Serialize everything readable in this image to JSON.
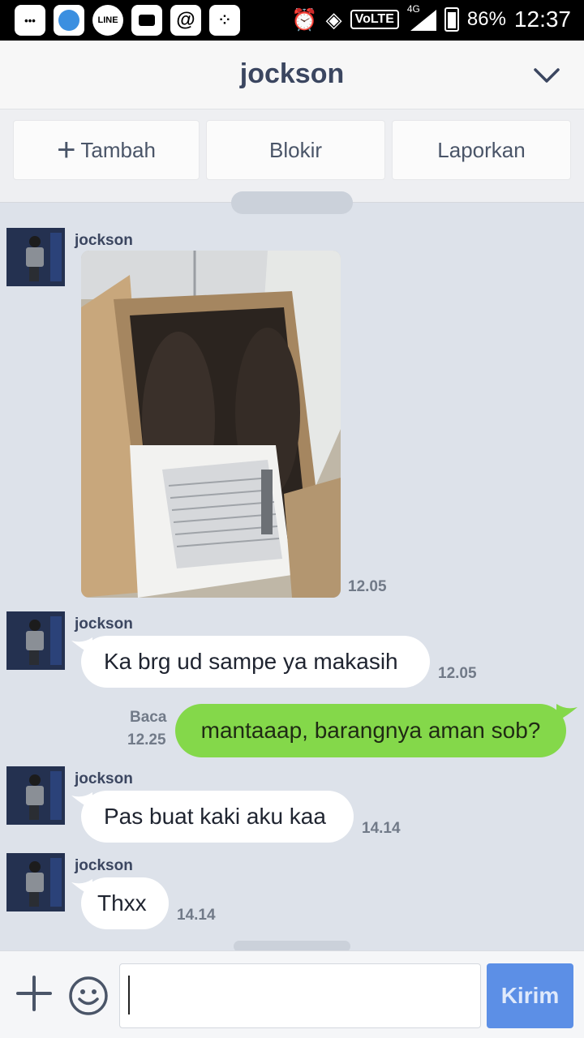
{
  "status_bar": {
    "icons": [
      "more-icon",
      "browser-icon",
      "line-app-icon",
      "chat-icon",
      "at-icon",
      "bbm-icon",
      "alarm-icon",
      "data-icon",
      "volte-icon",
      "signal-4g-icon",
      "battery-charging-icon"
    ],
    "line_label": "LINE",
    "volte_label": "VoLTE",
    "network": "4G",
    "battery": "86%",
    "time": "12:37"
  },
  "header": {
    "title": "jockson",
    "collapse_icon": "chevron-down-icon"
  },
  "actions": {
    "add_label": "Tambah",
    "block_label": "Blokir",
    "report_label": "Laporkan"
  },
  "messages": [
    {
      "sender": "jockson",
      "type": "image",
      "image_alt": "photo of shoes in a cardboard box with a packing slip",
      "time": "12.05"
    },
    {
      "sender": "jockson",
      "type": "text",
      "text": "Ka brg ud sampe ya makasih",
      "time": "12.05"
    },
    {
      "sender": "me",
      "type": "text",
      "text": "mantaaap, barangnya aman sob?",
      "status": "Baca",
      "time": "12.25"
    },
    {
      "sender": "jockson",
      "type": "text",
      "text": "Pas buat kaki aku kaa",
      "time": "14.14"
    },
    {
      "sender": "jockson",
      "type": "text",
      "text": "Thxx",
      "time": "14.14"
    }
  ],
  "input": {
    "value": "",
    "send_label": "Kirim"
  },
  "colors": {
    "header_text": "#3b4660",
    "chat_bg": "#dde2ea",
    "outgoing_bubble": "#84d84a",
    "send_button": "#5c8fe6"
  }
}
